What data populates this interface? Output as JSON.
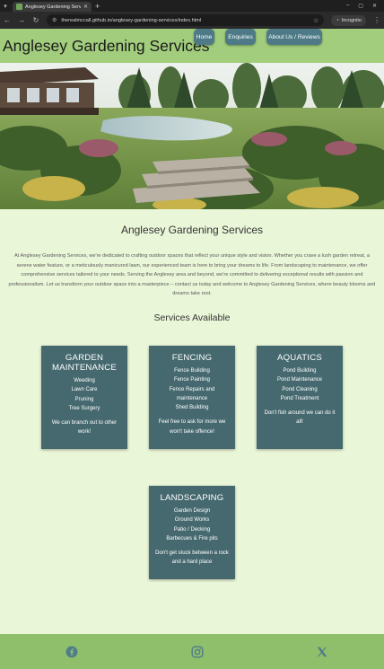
{
  "browser": {
    "tab_title": "Anglesey Gardening Services",
    "url": "therealmccall.github.io/anglesey-gardening-services/index.html",
    "incognito_label": "Incognito"
  },
  "header": {
    "site_title": "Anglesey Gardening Services",
    "nav": [
      {
        "label": "Home"
      },
      {
        "label": "Enquiries"
      },
      {
        "label": "About Us / Reviews"
      }
    ]
  },
  "intro": {
    "title": "Anglesey Gardening Services",
    "text": "At Anglesey Gardening Services, we're dedicated to crafting outdoor spaces that reflect your unique style and vision. Whether you crave a lush garden retreat, a serene water feature, or a meticulously manicured lawn, our experienced team is here to bring your dreams to life. From landscaping to maintenance, we offer comprehensive services tailored to your needs. Serving the Anglesey area and beyond, we're committed to delivering exceptional results with passion and professionalism. Let us transform your outdoor space into a masterpiece – contact us today and welcome to Anglesey Gardening Services, where beauty blooms and dreams take root."
  },
  "services": {
    "title": "Services Available",
    "cards": [
      {
        "title": "GARDEN MAINTENANCE",
        "items": [
          "Weeding",
          "Lawn Care",
          "Pruning",
          "Tree Surgery"
        ],
        "note": "We can branch out to other work!"
      },
      {
        "title": "FENCING",
        "items": [
          "Fence Building",
          "Fence Painting",
          "Fence Repairs and maintenance",
          "Shed Building"
        ],
        "note": "Feel free to ask for more we won't take offence!"
      },
      {
        "title": "AQUATICS",
        "items": [
          "Pond Building",
          "Pond Maintenance",
          "Pond Cleaning",
          "Pond Treatment"
        ],
        "note": "Don't fish around we can do it all!"
      },
      {
        "title": "LANDSCAPING",
        "items": [
          "Garden Design",
          "Ground Works",
          "Patio / Decking",
          "Barbecues & Fire pits"
        ],
        "note": "Don't get stuck between a rock and a hard place"
      }
    ]
  },
  "footer": {
    "icons": [
      "facebook-icon",
      "instagram-icon",
      "x-twitter-icon"
    ]
  },
  "colors": {
    "page_bg": "#eaf6d8",
    "header_bg": "#a1cd7c",
    "nav_button": "#4d7a86",
    "card_bg": "#45696f",
    "footer_bg": "#8fbf6a",
    "footer_icon": "#4f7c8a"
  }
}
